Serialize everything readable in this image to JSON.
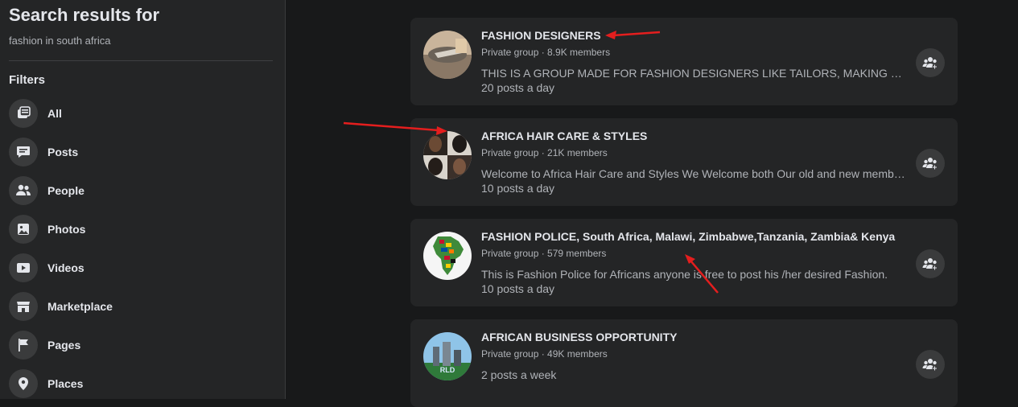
{
  "sidebar": {
    "title": "Search results for",
    "query": "fashion in south africa",
    "filters_heading": "Filters",
    "items": [
      {
        "label": "All",
        "icon": "all-icon"
      },
      {
        "label": "Posts",
        "icon": "posts-icon"
      },
      {
        "label": "People",
        "icon": "people-icon"
      },
      {
        "label": "Photos",
        "icon": "photos-icon"
      },
      {
        "label": "Videos",
        "icon": "videos-icon"
      },
      {
        "label": "Marketplace",
        "icon": "marketplace-icon"
      },
      {
        "label": "Pages",
        "icon": "pages-icon"
      },
      {
        "label": "Places",
        "icon": "places-icon"
      }
    ]
  },
  "results": [
    {
      "name": "FASHION DESIGNERS",
      "meta": "Private group · 8.9K members",
      "desc": "THIS IS A GROUP MADE FOR FASHION DESIGNERS LIKE TAILORS, MAKING OF BAG ...",
      "freq": "20 posts a day"
    },
    {
      "name": "AFRICA HAIR CARE & STYLES",
      "meta": "Private group · 21K members",
      "desc": "Welcome to Africa Hair Care and Styles We Welcome both Our old and new membe...",
      "freq": "10 posts a day"
    },
    {
      "name": "FASHION POLICE, South Africa, Malawi, Zimbabwe,Tanzania, Zambia& Kenya",
      "meta": "Private group · 579 members",
      "desc": "This is Fashion Police for Africans anyone is free to post his /her desired Fashion.",
      "freq": "10 posts a day"
    },
    {
      "name": "AFRICAN BUSINESS OPPORTUNITY",
      "meta": "Private group · 49K members",
      "desc": "",
      "freq": "2 posts a week"
    }
  ],
  "colors": {
    "accent_arrow": "#e41e1e",
    "card_bg": "#242526",
    "page_bg": "#18191a"
  }
}
